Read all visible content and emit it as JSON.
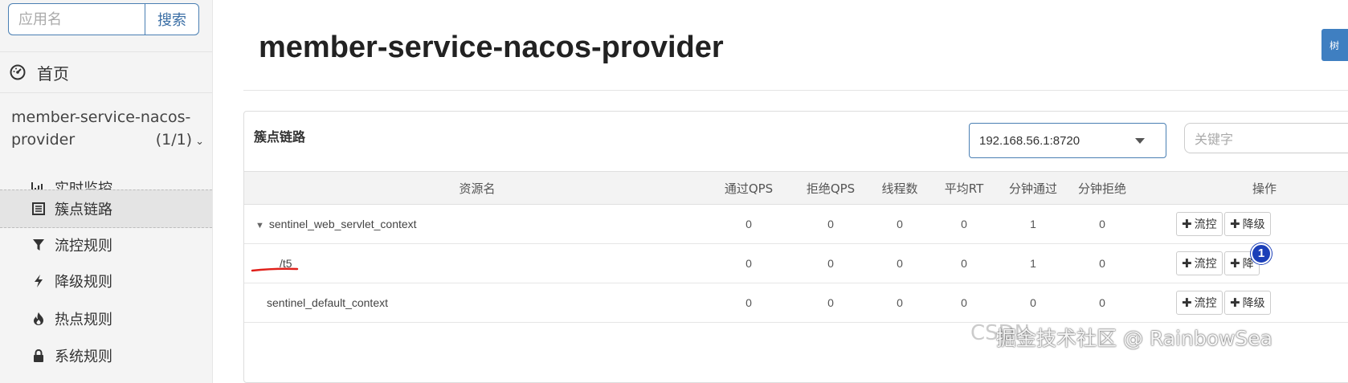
{
  "sidebar": {
    "search_placeholder": "应用名",
    "search_button": "搜索",
    "home_label": "首页",
    "app_name_line1": "member-service-nacos-",
    "app_name_line2": "provider",
    "app_count": "(1/1)",
    "menu": [
      {
        "label": "实时监控",
        "icon": "bar-chart-icon"
      },
      {
        "label": "簇点链路",
        "icon": "list-icon",
        "active": true
      },
      {
        "label": "流控规则",
        "icon": "filter-icon"
      },
      {
        "label": "降级规则",
        "icon": "bolt-icon"
      },
      {
        "label": "热点规则",
        "icon": "fire-icon"
      },
      {
        "label": "系统规则",
        "icon": "lock-icon"
      }
    ]
  },
  "main": {
    "title": "member-service-nacos-provider",
    "top_button": "树"
  },
  "panel": {
    "title": "簇点链路",
    "machine": "192.168.56.1:8720",
    "keyword_placeholder": "关键字"
  },
  "table": {
    "headers": [
      "资源名",
      "通过QPS",
      "拒绝QPS",
      "线程数",
      "平均RT",
      "分钟通过",
      "分钟拒绝",
      "操作"
    ],
    "rows": [
      {
        "resource": "sentinel_web_servlet_context",
        "expandable": true,
        "values": [
          "0",
          "0",
          "0",
          "0",
          "1",
          "0"
        ]
      },
      {
        "resource": "/t5",
        "expandable": false,
        "values": [
          "0",
          "0",
          "0",
          "0",
          "1",
          "0"
        ]
      },
      {
        "resource": "sentinel_default_context",
        "expandable": false,
        "values": [
          "0",
          "0",
          "0",
          "0",
          "0",
          "0"
        ]
      }
    ],
    "actions": {
      "flow": "流控",
      "degrade": "降级",
      "degrade_partial": "降"
    }
  },
  "overlay": {
    "badge": "1",
    "watermark_back": "CSDN",
    "watermark_front": "掘金技术社区 @ RainbowSea"
  }
}
